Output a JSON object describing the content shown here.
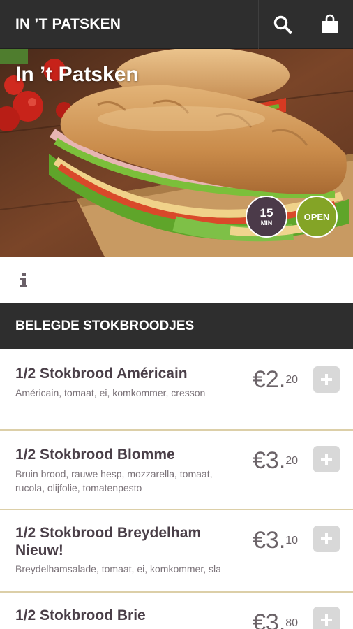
{
  "header": {
    "brand": "IN ’T PATSKEN",
    "search_icon": "search-icon",
    "cart_icon": "shopping-bag-icon"
  },
  "hero": {
    "title": "In ’t Patsken",
    "prep_time_value": "15",
    "prep_time_unit": "MIN",
    "status": "OPEN",
    "status_color": "#84a426",
    "time_badge_color": "#4b3a49"
  },
  "info": {
    "icon": "info-icon"
  },
  "category": {
    "title": "BELEGDE STOKBROODJES"
  },
  "products": [
    {
      "name": "1/2 Stokbrood Américain",
      "description": "Américain, tomaat, ei, komkommer, cresson",
      "price_main": "€2.",
      "price_cents": "20"
    },
    {
      "name": "1/2 Stokbrood Blomme",
      "description": "Bruin brood, rauwe hesp, mozzarella, tomaat, rucola, olijfolie, tomatenpesto",
      "price_main": "€3.",
      "price_cents": "20"
    },
    {
      "name": "1/2 Stokbrood Breydelham Nieuw!",
      "description": "Breydelhamsalade, tomaat, ei, komkommer, sla",
      "price_main": "€3.",
      "price_cents": "10"
    },
    {
      "name": "1/2 Stokbrood Brie",
      "description": "",
      "price_main": "€3.",
      "price_cents": "80"
    }
  ],
  "colors": {
    "topbar": "#2e2e2e",
    "separator": "#dccfa8",
    "add_button": "#d8d8d8"
  }
}
